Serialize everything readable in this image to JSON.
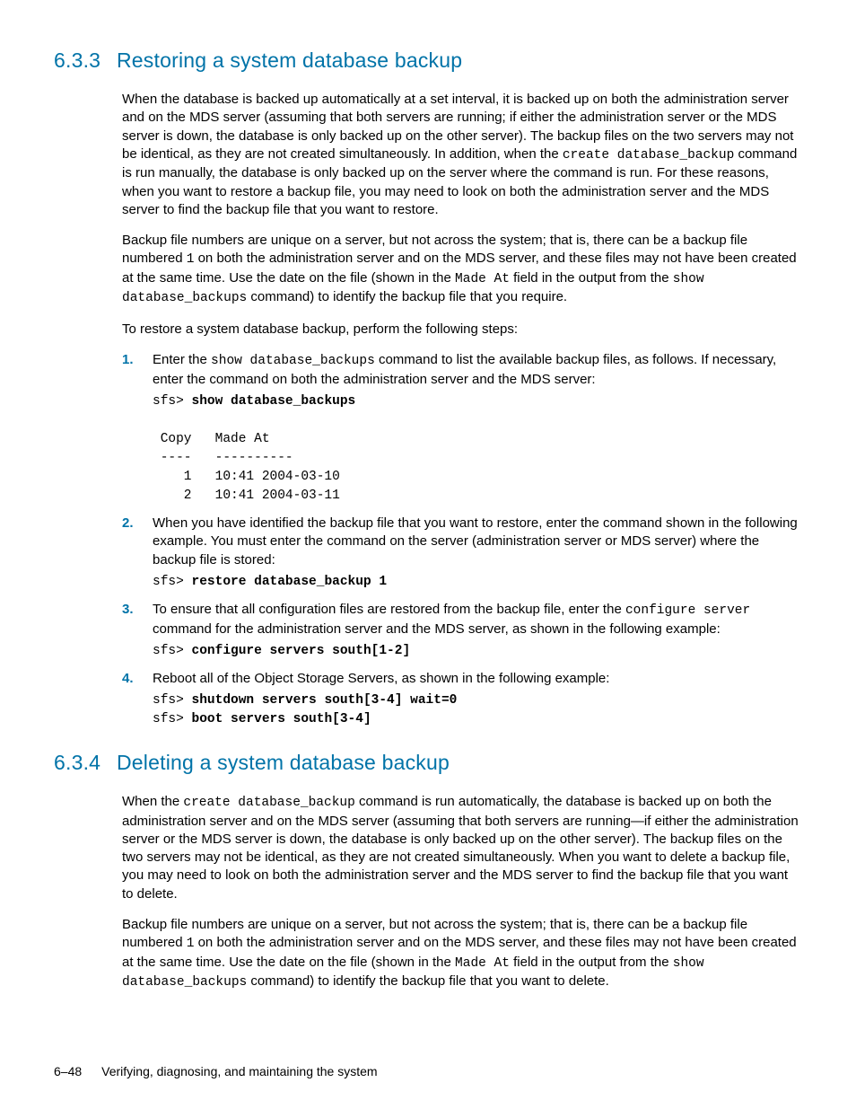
{
  "section633": {
    "number": "6.3.3",
    "title": "Restoring a system database backup",
    "para1a": "When the database is backed up automatically at a set interval, it is backed up on both the administration server and on the MDS server (assuming that both servers are running; if either the administration server or the MDS server is down, the database is only backed up on the other server). The backup files on the two servers may not be identical, as they are not created simultaneously. In addition, when the ",
    "para1_code1": "create database_backup",
    "para1b": " command is run manually, the database is only backed up on the server where the command is run. For these reasons, when you want to restore a backup file, you may need to look on both the administration server and the MDS server to find the backup file that you want to restore.",
    "para2a": "Backup file numbers are unique on a server, but not across the system; that is, there can be a backup file numbered ",
    "para2_code1": "1",
    "para2b": " on both the administration server and on the MDS server, and these files may not have been created at the same time. Use the date on the file (shown in the ",
    "para2_code2": "Made At",
    "para2c": " field in the output from the ",
    "para2_code3": "show database_backups",
    "para2d": " command) to identify the backup file that you require.",
    "para3": "To restore a system database backup, perform the following steps:",
    "steps": {
      "s1": {
        "marker": "1.",
        "text_a": "Enter the ",
        "code1": "show database_backups",
        "text_b": " command to list the available backup files, as follows. If necessary, enter the command on both the administration server and the MDS server:",
        "cmd_prefix": "sfs> ",
        "cmd_bold": "show database_backups",
        "output": " Copy   Made At\n ----   ----------\n    1   10:41 2004-03-10\n    2   10:41 2004-03-11"
      },
      "s2": {
        "marker": "2.",
        "text": "When you have identified the backup file that you want to restore, enter the command shown in the following example. You must enter the command on the server (administration server or MDS server) where the backup file is stored:",
        "cmd_prefix": "sfs> ",
        "cmd_bold": "restore database_backup 1"
      },
      "s3": {
        "marker": "3.",
        "text_a": "To ensure that all configuration files are restored from the backup file, enter the ",
        "code1": "configure server",
        "text_b": " command for the administration server and the MDS server, as shown in the following example:",
        "cmd_prefix": "sfs> ",
        "cmd_bold": "configure servers south[1-2]"
      },
      "s4": {
        "marker": "4.",
        "text": "Reboot all of the Object Storage Servers, as shown in the following example:",
        "cmd1_prefix": "sfs> ",
        "cmd1_bold": "shutdown servers south[3-4] wait=0",
        "cmd2_prefix": "sfs> ",
        "cmd2_bold": "boot servers south[3-4]"
      }
    }
  },
  "section634": {
    "number": "6.3.4",
    "title": "Deleting a system database backup",
    "para1a": "When the ",
    "para1_code1": "create database_backup",
    "para1b": " command is run automatically, the database is backed up on both the administration server and on the MDS server (assuming that both servers are running—if either the administration server or the MDS server is down, the database is only backed up on the other server). The backup files on the two servers may not be identical, as they are not created simultaneously. When you want to delete a backup file, you may need to look on both the administration server and the MDS server to find the backup file that you want to delete.",
    "para2a": "Backup file numbers are unique on a server, but not across the system; that is, there can be a backup file numbered ",
    "para2_code1": "1",
    "para2b": " on both the administration server and on the MDS server, and these files may not have been created at the same time. Use the date on the file (shown in the ",
    "para2_code2": "Made At",
    "para2c": " field in the output from the ",
    "para2_code3": "show database_backups",
    "para2d": " command) to identify the backup file that you want to delete."
  },
  "footer": {
    "page": "6–48",
    "title": "Verifying, diagnosing, and maintaining the system"
  }
}
